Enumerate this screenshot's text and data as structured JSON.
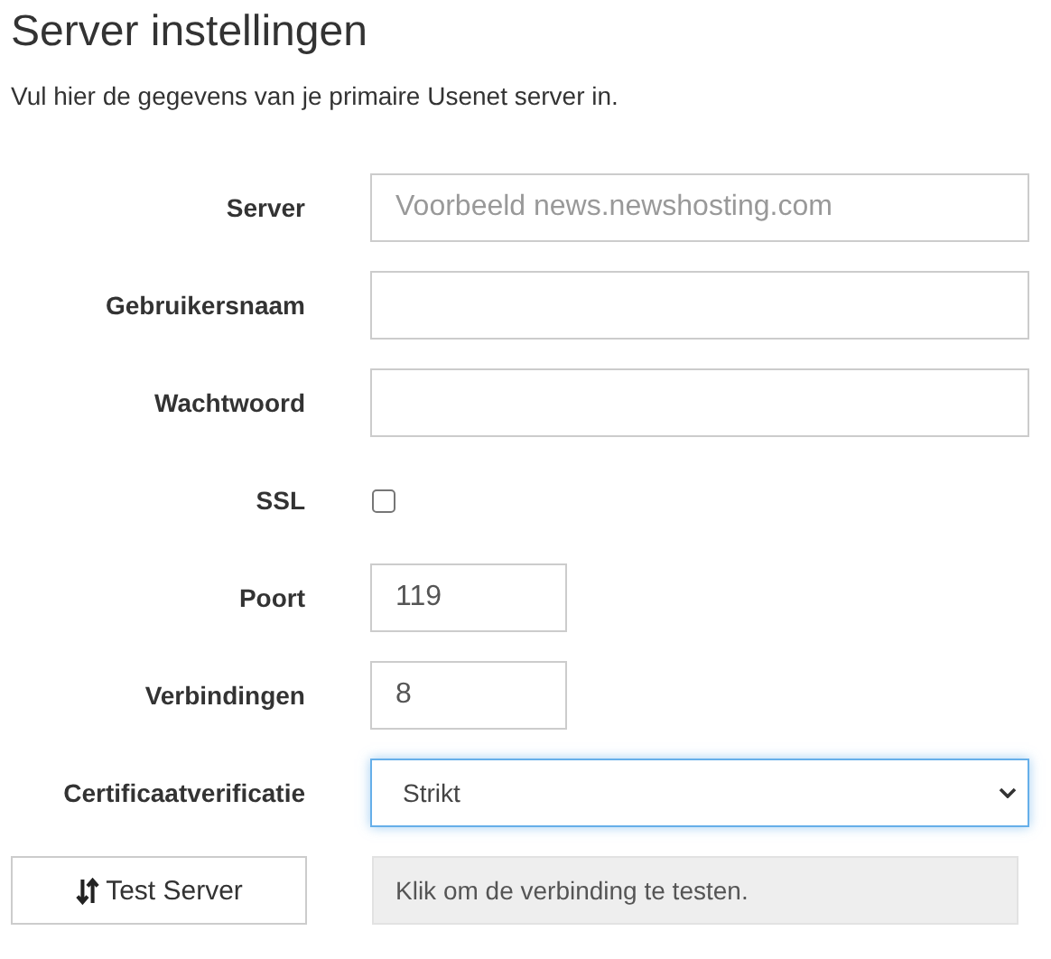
{
  "title": "Server instellingen",
  "intro": "Vul hier de gegevens van je primaire Usenet server in.",
  "fields": [
    {
      "kind": "text",
      "label": "Server",
      "placeholder": "Voorbeeld news.newshosting.com"
    },
    {
      "kind": "text",
      "label": "Gebruikersnaam"
    },
    {
      "kind": "password",
      "label": "Wachtwoord"
    },
    {
      "kind": "checkbox",
      "label": "SSL",
      "checked": false
    },
    {
      "kind": "number",
      "label": "Poort",
      "value": "119"
    },
    {
      "kind": "number",
      "label": "Verbindingen",
      "value": "8"
    },
    {
      "kind": "select",
      "label": "Certificaatverificatie",
      "value": "Strikt",
      "focused": true
    }
  ],
  "test": {
    "button": "Test Server",
    "status": "Klik om de verbinding te testen."
  }
}
